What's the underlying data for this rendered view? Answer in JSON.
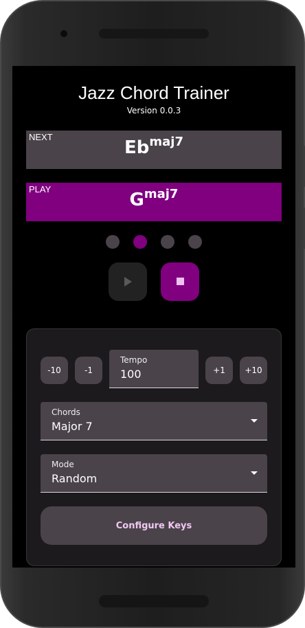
{
  "app": {
    "title": "Jazz Chord Trainer",
    "version": "Version 0.0.3"
  },
  "next": {
    "label": "NEXT",
    "root": "Eb",
    "quality": "maj7"
  },
  "play": {
    "label": "PLAY",
    "root": "G",
    "quality": "maj7"
  },
  "beats": {
    "count": 4,
    "active_index": 1
  },
  "controls": {
    "play_icon": "play-icon",
    "stop_icon": "stop-icon"
  },
  "tempo": {
    "minus10": "-10",
    "minus1": "-1",
    "label": "Tempo",
    "value": "100",
    "plus1": "+1",
    "plus10": "+10"
  },
  "chords_select": {
    "label": "Chords",
    "value": "Major 7"
  },
  "mode_select": {
    "label": "Mode",
    "value": "Random"
  },
  "configure_button": "Configure Keys",
  "colors": {
    "accent": "#800080",
    "surface": "#4a434a",
    "background": "#000000"
  }
}
